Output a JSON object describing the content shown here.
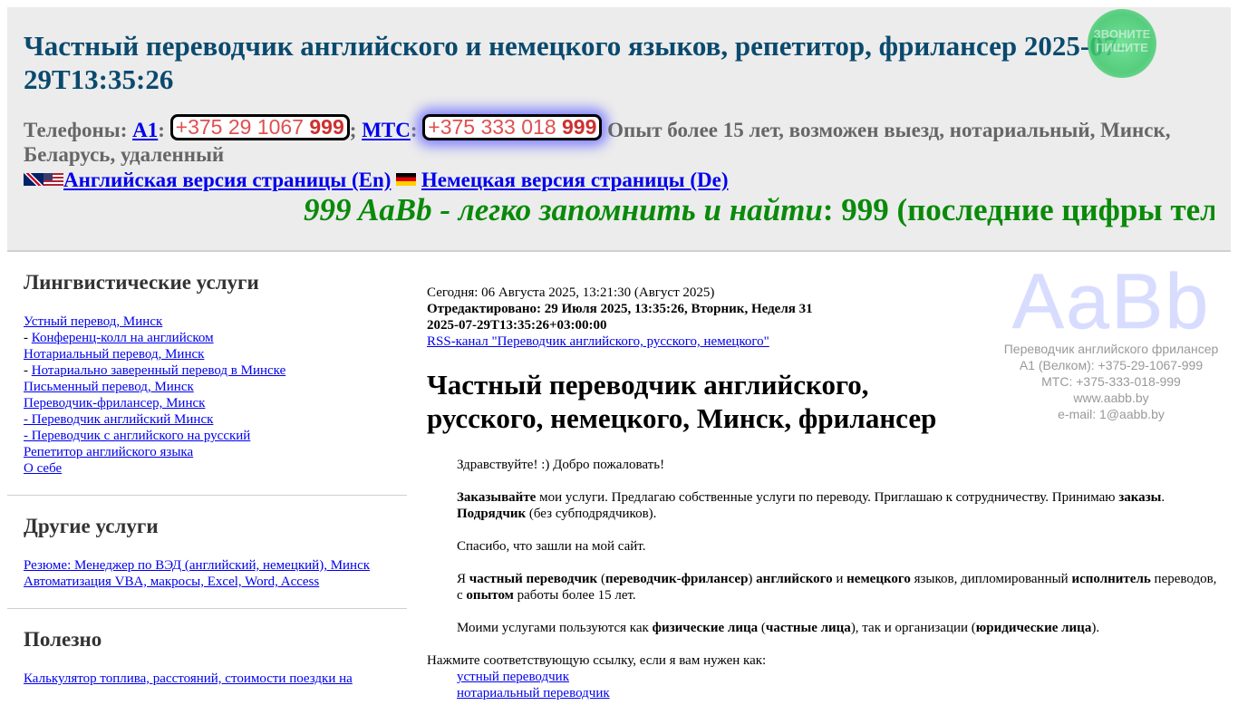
{
  "header": {
    "title": "Частный переводчик английского и немецкого языков, репетитор, фрилансер 2025-07-29T13:35:26",
    "badge_text": "ЗВОНИТЕ ПИШИТЕ",
    "phones_label": "Телефоны:",
    "operator1": "A1",
    "phone1_main": "+375 29 1067 ",
    "phone1_tail": "999",
    "operator2": "МТС",
    "phone2_main": "+375 333 018 ",
    "phone2_tail": "999",
    "experience": "Опыт более 15 лет, возможен выезд, нотариальный, Минск, Беларусь, удаленный",
    "english_link": "Английская версия страницы (En)",
    "german_link": "Немецкая версия страницы (De)",
    "marquee_italic": "999 AaBb - легко запомнить и найти",
    "marquee_rest": ": 999 (последние цифры тел"
  },
  "sidebar": {
    "sections": [
      {
        "title": "Лингвистические услуги",
        "items": [
          {
            "prefix": "",
            "label": "Устный перевод, Минск"
          },
          {
            "prefix": "- ",
            "label": "Конференц-колл на английском"
          },
          {
            "prefix": "",
            "label": "Нотариальный перевод, Минск"
          },
          {
            "prefix": "- ",
            "label": "Нотариально заверенный перевод в Минске"
          },
          {
            "prefix": "",
            "label": "Письменный перевод, Минск"
          },
          {
            "prefix": "",
            "label": "Переводчик-фрилансер, Минск"
          },
          {
            "prefix": "",
            "label": "- Переводчик английский Минск"
          },
          {
            "prefix": "",
            "label": "- Переводчик с английского на русский"
          },
          {
            "prefix": "",
            "label": "Репетитор английского языка"
          },
          {
            "prefix": "",
            "label": "О себе"
          }
        ]
      },
      {
        "title": "Другие услуги",
        "items": [
          {
            "prefix": "",
            "label": "Резюме: Менеджер по ВЭД (английский, немецкий), Минск"
          },
          {
            "prefix": "",
            "label": "Автоматизация VBA, макросы, Excel, Word, Access"
          }
        ]
      },
      {
        "title": "Полезно",
        "items": [
          {
            "prefix": "",
            "label": "Калькулятор топлива, расстояний, стоимости поездки на"
          }
        ]
      }
    ]
  },
  "main": {
    "today": "Сегодня: 06 Августа 2025, 13:21:30 (Август 2025)",
    "edited": "Отредактировано: 29 Июля 2025, 13:35:26, Вторник, Неделя 31",
    "iso": "2025-07-29T13:35:26+03:00:00",
    "rss": "RSS-канал \"Переводчик английского, русского, немецкого\"",
    "logo": {
      "mark": "AaBb",
      "lines": [
        "Переводчик английского фрилансер",
        "A1 (Велком): +375-29-1067-999",
        "МТС:            +375-333-018-999",
        "www.aabb.by",
        "e-mail: 1@aabb.by"
      ]
    },
    "heading": "Частный переводчик английского, русского, немецкого, Минск, фрилансер",
    "greeting": "Здравствуйте! :) Добро пожаловать!",
    "p2": {
      "b1": "Заказывайте",
      "t1": " мои услуги. Предлагаю собственные услуги по переводу. Приглашаю к сотрудничеству. Принимаю ",
      "b2": "заказы",
      "t2": ". ",
      "b3": "Подрядчик",
      "t3": " (без субподрядчиков)."
    },
    "thanks": "Спасибо, что зашли на мой сайт.",
    "p4": {
      "t0": "Я ",
      "b1": "частный переводчик",
      "t1": " (",
      "b2": "переводчик-фрилансер",
      "t2": ") ",
      "b3": "английского",
      "t3": " и ",
      "b4": "немецкого",
      "t4": " языков, дипломированный ",
      "b5": "исполнитель",
      "t5": " переводов, с ",
      "b6": "опытом",
      "t6": " работы более 15 лет."
    },
    "p5": {
      "t0": "Моими услугами пользуются как ",
      "b1": "физические лица",
      "t1": " (",
      "b2": "частные лица",
      "t2": "), так и организации (",
      "b3": "юридические лица",
      "t3": ")."
    },
    "links_intro": "Нажмите соответствующую ссылку, если я вам нужен как:",
    "links": [
      "устный переводчик",
      "нотариальный переводчик"
    ]
  }
}
